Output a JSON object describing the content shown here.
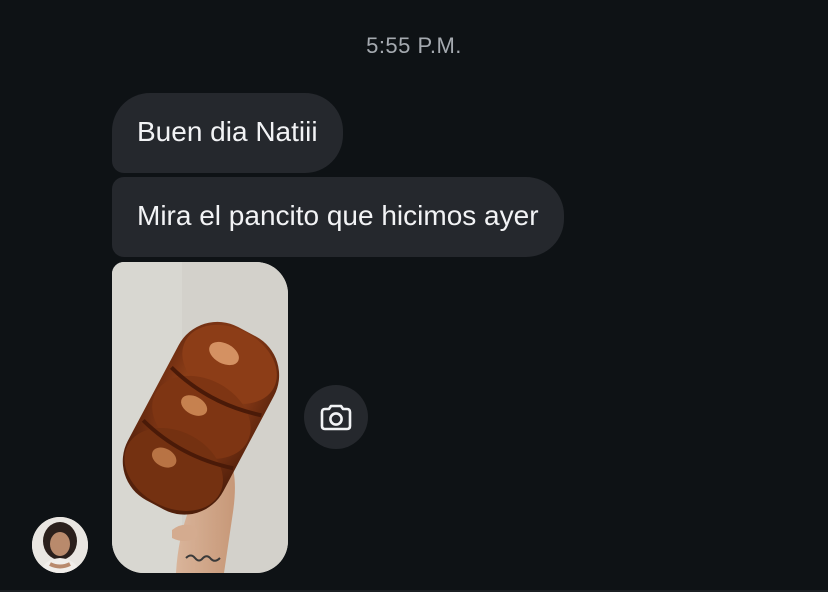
{
  "conversation": {
    "timestamp": "5:55 P.M.",
    "messages": [
      {
        "text": "Buen dia Natiii"
      },
      {
        "text": "Mira el pancito que hicimos ayer"
      }
    ],
    "photo_icon": "bread-loaf-photo",
    "camera_icon": "camera-icon",
    "avatar_icon": "sender-avatar"
  },
  "colors": {
    "background": "#0e1215",
    "bubble": "#25282d",
    "text": "#f2f3f5",
    "timestamp": "#a5aab0"
  }
}
